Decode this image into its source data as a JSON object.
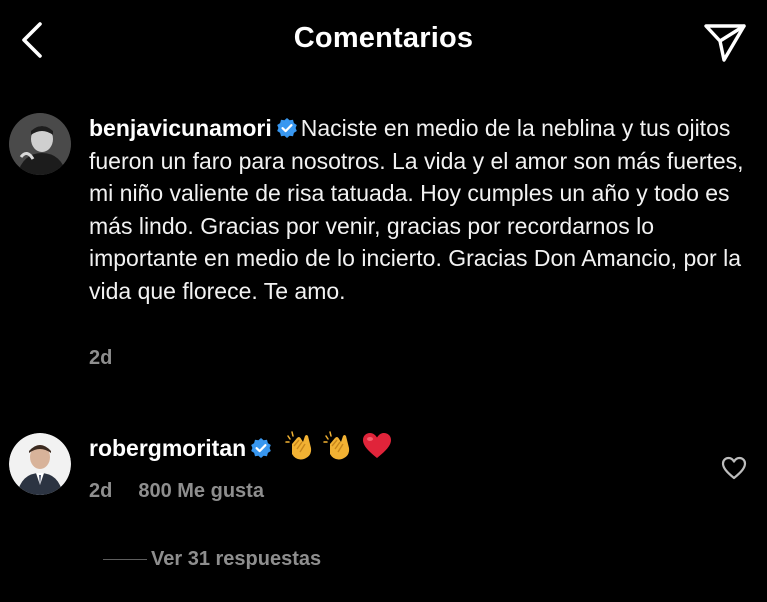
{
  "header": {
    "title": "Comentarios",
    "back_icon": "chevron-left-icon",
    "send_icon": "paper-plane-icon"
  },
  "caption": {
    "username": "benjavicunamori",
    "verified": true,
    "text": "Naciste en medio de la neblina y tus ojitos fueron un faro para nosotros. La vida y el amor son más fuertes, mi niño valiente de risa tatuada. Hoy cumples un año y todo es más lindo. Gracias por venir, gracias por recordarnos lo importante en medio de lo incierto. Gracias Don Amancio, por la vida que florece. Te amo.",
    "time": "2d"
  },
  "comment": {
    "username": "robergmoritan",
    "verified": true,
    "emojis": [
      "clapping-hands-emoji",
      "clapping-hands-emoji",
      "red-heart-emoji"
    ],
    "time": "2d",
    "likes": "800 Me gusta",
    "like_icon": "heart-outline-icon"
  },
  "replies": {
    "label": "Ver 31 respuestas"
  },
  "colors": {
    "background": "#000000",
    "text": "#ffffff",
    "secondary": "#8e8e8e",
    "verified": "#3897f0",
    "heart": "#e0243a"
  }
}
